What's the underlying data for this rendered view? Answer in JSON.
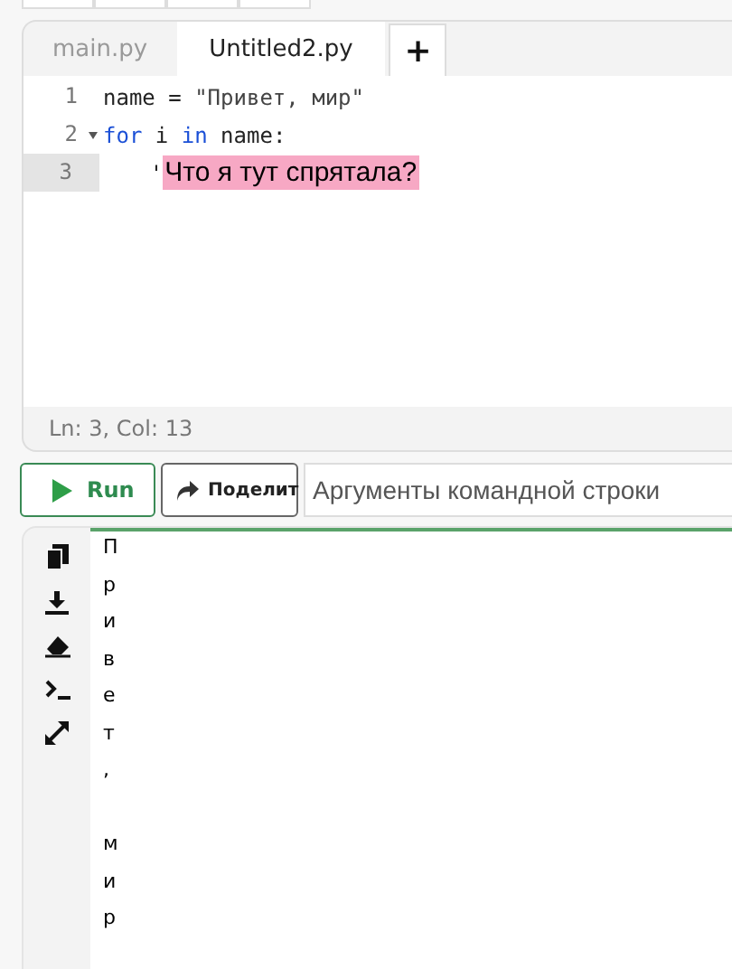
{
  "tabs": [
    {
      "label": "main.py",
      "selected": false
    },
    {
      "label": "Untitled2.py",
      "selected": true
    }
  ],
  "add_tab": "+",
  "code_lines": [
    {
      "number": "1",
      "foldable": false,
      "current": false,
      "tokens": [
        {
          "text": "name = ",
          "kind": "plain"
        },
        {
          "text": "\"Привет, мир\"",
          "kind": "string"
        }
      ]
    },
    {
      "number": "2",
      "foldable": true,
      "current": false,
      "tokens": [
        {
          "text": "for",
          "kind": "keyword"
        },
        {
          "text": " i ",
          "kind": "plain"
        },
        {
          "text": "in",
          "kind": "keyword"
        },
        {
          "text": " name:",
          "kind": "plain"
        }
      ]
    },
    {
      "number": "3",
      "foldable": false,
      "current": true,
      "tokens": [
        {
          "text": "    '",
          "kind": "plain"
        },
        {
          "text": "Что я тут спрятала?",
          "kind": "highlight"
        }
      ]
    }
  ],
  "status": "Ln: 3,  Col: 13",
  "run_button": "Run",
  "share_button": "Поделит",
  "args_field": {
    "placeholder": "Аргументы командной строки"
  },
  "output_lines": [
    {
      "kind": "text",
      "text": "П"
    },
    {
      "kind": "text",
      "text": "р"
    },
    {
      "kind": "text",
      "text": "и"
    },
    {
      "kind": "text",
      "text": "в"
    },
    {
      "kind": "text",
      "text": "е"
    },
    {
      "kind": "text",
      "text": "т"
    },
    {
      "kind": "text",
      "text": ","
    },
    {
      "kind": "blank"
    },
    {
      "kind": "text",
      "text": "м"
    },
    {
      "kind": "text",
      "text": "и"
    },
    {
      "kind": "text",
      "text": "р"
    }
  ]
}
